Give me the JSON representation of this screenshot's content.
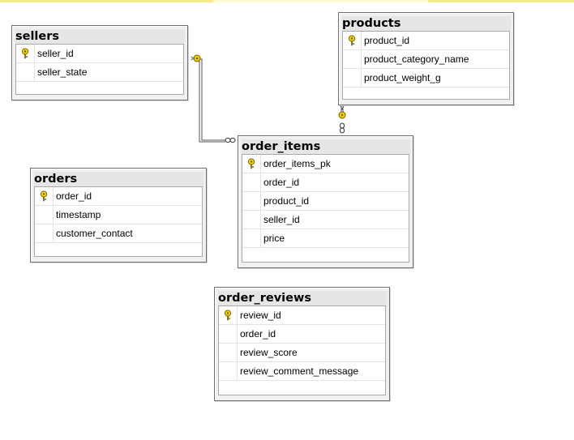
{
  "colors": {
    "background": "#ffffff",
    "table_header": "#e6e6e6",
    "border": "#6f6f6f",
    "relationship_line": "#555555",
    "key_icon": "#f2d600",
    "top_strip": "#f5ec8a"
  },
  "tables": {
    "sellers": {
      "title": "sellers",
      "columns": [
        {
          "name": "seller_id",
          "primary_key": true
        },
        {
          "name": "seller_state",
          "primary_key": false
        }
      ]
    },
    "products": {
      "title": "products",
      "columns": [
        {
          "name": "product_id",
          "primary_key": true
        },
        {
          "name": "product_category_name",
          "primary_key": false
        },
        {
          "name": "product_weight_g",
          "primary_key": false
        }
      ]
    },
    "order_items": {
      "title": "order_items",
      "columns": [
        {
          "name": "order_items_pk",
          "primary_key": true
        },
        {
          "name": "order_id",
          "primary_key": false
        },
        {
          "name": "product_id",
          "primary_key": false
        },
        {
          "name": "seller_id",
          "primary_key": false
        },
        {
          "name": "price",
          "primary_key": false
        }
      ]
    },
    "orders": {
      "title": "orders",
      "columns": [
        {
          "name": "order_id",
          "primary_key": true
        },
        {
          "name": "timestamp",
          "primary_key": false
        },
        {
          "name": "customer_contact",
          "primary_key": false
        }
      ]
    },
    "order_reviews": {
      "title": "order_reviews",
      "columns": [
        {
          "name": "review_id",
          "primary_key": true
        },
        {
          "name": "order_id",
          "primary_key": false
        },
        {
          "name": "review_score",
          "primary_key": false
        },
        {
          "name": "review_comment_message",
          "primary_key": false
        }
      ]
    }
  },
  "relationships": [
    {
      "from_table": "sellers",
      "to_table": "order_items",
      "one_end": "sellers",
      "many_end": "order_items"
    },
    {
      "from_table": "products",
      "to_table": "order_items",
      "one_end": "products",
      "many_end": "order_items"
    }
  ]
}
